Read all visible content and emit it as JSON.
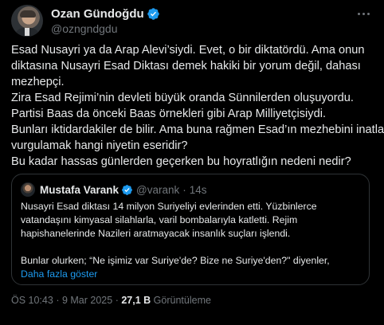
{
  "author": {
    "display_name": "Ozan Gündoğdu",
    "handle": "@ozngndgdu"
  },
  "tweet_lines": [
    "Esad Nusayri ya da Arap Alevi’siydi. Evet, o bir diktatördü. Ama onun",
    "diktasına Nusayri Esad Diktası demek hakiki bir yorum değil, dahası",
    "mezhepçi.",
    "Zira Esad Rejimi’nin devleti büyük oranda Sünnilerden oluşuyordu.",
    "Partisi Baas da önceki Baas örnekleri gibi Arap Milliyetçisiydi.",
    "Bunları iktidardakiler de bilir. Ama buna rağmen Esad’ın mezhebini inatla",
    "vurgulamak hangi niyetin eseridir?",
    "Bu kadar hassas günlerden geçerken bu hoyratlığın nedeni nedir?"
  ],
  "quoted": {
    "display_name": "Mustafa Varank",
    "handle": "@varank",
    "separator": "·",
    "time": "14s",
    "lines": [
      "Nusayri Esad diktası 14 milyon Suriyeliyi evlerinden etti. Yüzbinlerce",
      "vatandaşını kimyasal silahlarla, varil bombalarıyla katletti. Rejim",
      "hapishanelerinde Nazileri aratmayacak insanlık suçları işlendi.",
      "Bunlar olurken; “Ne işimiz var Suriye'de? Bize ne Suriye'den?\" diyenler,"
    ],
    "show_more": "Daha fazla göster"
  },
  "footer": {
    "time": "ÖS 10:43",
    "separator": "·",
    "date": "9 Mar 2025",
    "views_count": "27,1 B",
    "views_label": "Görüntüleme"
  },
  "colors": {
    "background": "#000000",
    "text": "#e7e9ea",
    "muted": "#71767b",
    "link": "#1d9bf0",
    "border": "#2f3336",
    "verified": "#1d9bf0"
  },
  "icons": [
    "verified-badge-icon",
    "more-options-icon"
  ]
}
